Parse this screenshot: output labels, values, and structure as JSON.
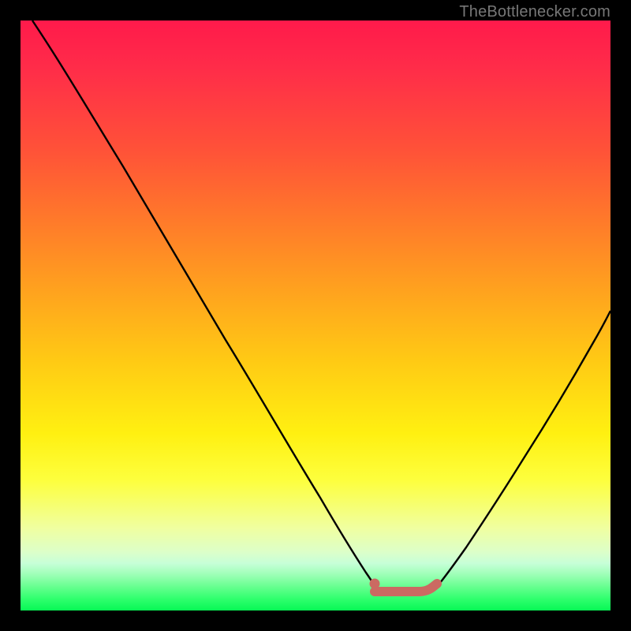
{
  "attribution": "TheBottlenecker.com",
  "colors": {
    "indicator": "#cb6a62",
    "curve": "#000000"
  },
  "chart_data": {
    "type": "line",
    "title": "",
    "xlabel": "",
    "ylabel": "",
    "xlim": [
      0,
      100
    ],
    "ylim": [
      0,
      100
    ],
    "series": [
      {
        "name": "left-curve",
        "x": [
          2,
          7,
          13,
          19,
          25,
          32,
          38,
          44,
          50,
          56,
          59.5
        ],
        "values": [
          100,
          91,
          80,
          69,
          58,
          47,
          37,
          27,
          18,
          9,
          4
        ]
      },
      {
        "name": "right-curve",
        "x": [
          70,
          74,
          78,
          82,
          86,
          90,
          94,
          98,
          100
        ],
        "values": [
          4,
          8,
          14,
          21,
          29,
          37,
          46,
          55,
          60
        ]
      },
      {
        "name": "optimal-band",
        "x": [
          59.5,
          70
        ],
        "values": [
          4,
          4
        ]
      }
    ],
    "annotations": [
      {
        "name": "indicator-dot",
        "x": 59.5,
        "y": 5
      },
      {
        "name": "indicator-segment",
        "x0": 59.5,
        "x1": 70,
        "y": 3.6
      }
    ]
  }
}
